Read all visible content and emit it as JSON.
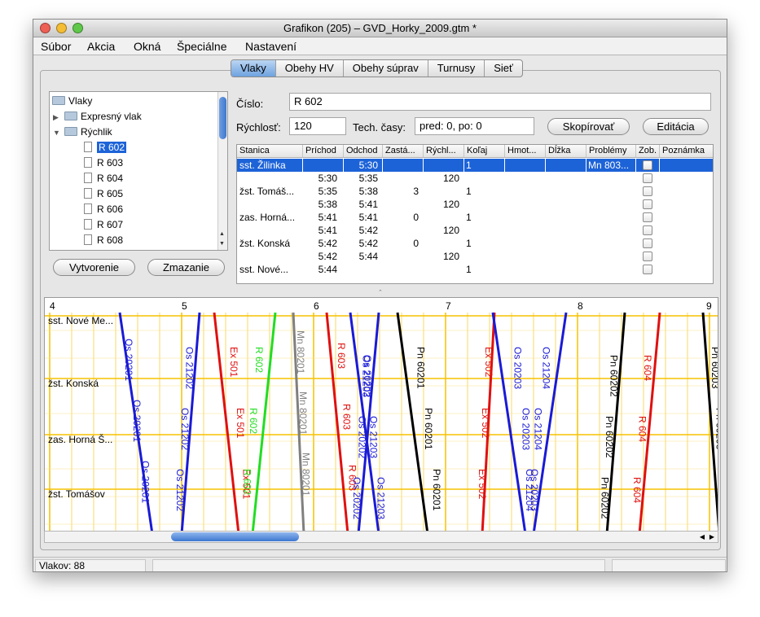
{
  "window": {
    "title": "Grafikon (205) – GVD_Horky_2009.gtm *"
  },
  "menu": [
    "Súbor",
    "Akcia",
    "Okná",
    "Špeciálne",
    "Nastavení"
  ],
  "tabs": [
    "Vlaky",
    "Obehy HV",
    "Obehy súprav",
    "Turnusy",
    "Sieť"
  ],
  "tree": {
    "root": "Vlaky",
    "groups": [
      {
        "label": "Expresný vlak",
        "expanded": false
      },
      {
        "label": "Rýchlik",
        "expanded": true
      }
    ],
    "items": [
      "R 602",
      "R 603",
      "R 604",
      "R 605",
      "R 606",
      "R 607",
      "R 608"
    ],
    "selected": "R 602"
  },
  "buttons": {
    "create": "Vytvorenie",
    "delete": "Zmazanie",
    "copy": "Skopírovať",
    "edit": "Editácia"
  },
  "form": {
    "number_label": "Číslo:",
    "number_value": "R 602",
    "speed_label": "Rýchlosť:",
    "speed_value": "120",
    "tech_label": "Tech. časy:",
    "tech_value": "pred: 0, po: 0"
  },
  "table": {
    "columns": [
      "Stanica",
      "Príchod",
      "Odchod",
      "Zastá...",
      "Rýchl...",
      "Koľaj",
      "Hmot...",
      "Dĺžka",
      "Problémy",
      "Zob.",
      "Poznámka"
    ],
    "rows": [
      {
        "station": "sst. Žilinka",
        "arr": "",
        "dep": "5:30",
        "stop": "",
        "speed": "",
        "track": "1",
        "problems": "Mn 803...",
        "selected": true
      },
      {
        "station": "",
        "arr": "5:30",
        "dep": "5:35",
        "stop": "",
        "speed": "120",
        "track": "",
        "problems": "",
        "selected": false
      },
      {
        "station": "žst. Tomáš...",
        "arr": "5:35",
        "dep": "5:38",
        "stop": "3",
        "speed": "",
        "track": "1",
        "problems": "",
        "selected": false
      },
      {
        "station": "",
        "arr": "5:38",
        "dep": "5:41",
        "stop": "",
        "speed": "120",
        "track": "",
        "problems": "",
        "selected": false
      },
      {
        "station": "zas. Horná...",
        "arr": "5:41",
        "dep": "5:41",
        "stop": "0",
        "speed": "",
        "track": "1",
        "problems": "",
        "selected": false
      },
      {
        "station": "",
        "arr": "5:41",
        "dep": "5:42",
        "stop": "",
        "speed": "120",
        "track": "",
        "problems": "",
        "selected": false
      },
      {
        "station": "žst. Konská",
        "arr": "5:42",
        "dep": "5:42",
        "stop": "0",
        "speed": "",
        "track": "1",
        "problems": "",
        "selected": false
      },
      {
        "station": "",
        "arr": "5:42",
        "dep": "5:44",
        "stop": "",
        "speed": "120",
        "track": "",
        "problems": "",
        "selected": false
      },
      {
        "station": "sst. Nové...",
        "arr": "5:44",
        "dep": "",
        "stop": "",
        "speed": "",
        "track": "1",
        "problems": "",
        "selected": false
      }
    ]
  },
  "graph": {
    "hours": [
      "4",
      "5",
      "6",
      "7",
      "8",
      "9"
    ],
    "stations": [
      "sst. Nové Me...",
      "žst. Konská",
      "zas. Horná Š...",
      "žst. Tomášov"
    ],
    "colors": {
      "os": "#1a1ad6",
      "ex": "#e01010",
      "r": "#e01010",
      "pn": "#000000",
      "mn": "#808080",
      "r602": "#22dd22",
      "grid": "#f5c200"
    },
    "trains": [
      {
        "label": "Os 20201",
        "color": "#1a1ad6"
      },
      {
        "label": "Os 21202",
        "color": "#1a1ad6"
      },
      {
        "label": "Ex 501",
        "color": "#e01010"
      },
      {
        "label": "R 602",
        "color": "#22dd22"
      },
      {
        "label": "Mn 80201",
        "color": "#808080"
      },
      {
        "label": "R 603",
        "color": "#e01010"
      },
      {
        "label": "Os 21203",
        "color": "#1a1ad6"
      },
      {
        "label": "Os 20202",
        "color": "#1a1ad6"
      },
      {
        "label": "Pn 60201",
        "color": "#000000"
      },
      {
        "label": "Ex 502",
        "color": "#e01010"
      },
      {
        "label": "Os 20203",
        "color": "#1a1ad6"
      },
      {
        "label": "Os 21204",
        "color": "#1a1ad6"
      },
      {
        "label": "Pn 60202",
        "color": "#000000"
      },
      {
        "label": "R 604",
        "color": "#e01010"
      },
      {
        "label": "Pn 60203",
        "color": "#000000"
      }
    ]
  },
  "status": {
    "count": "Vlakov: 88"
  }
}
